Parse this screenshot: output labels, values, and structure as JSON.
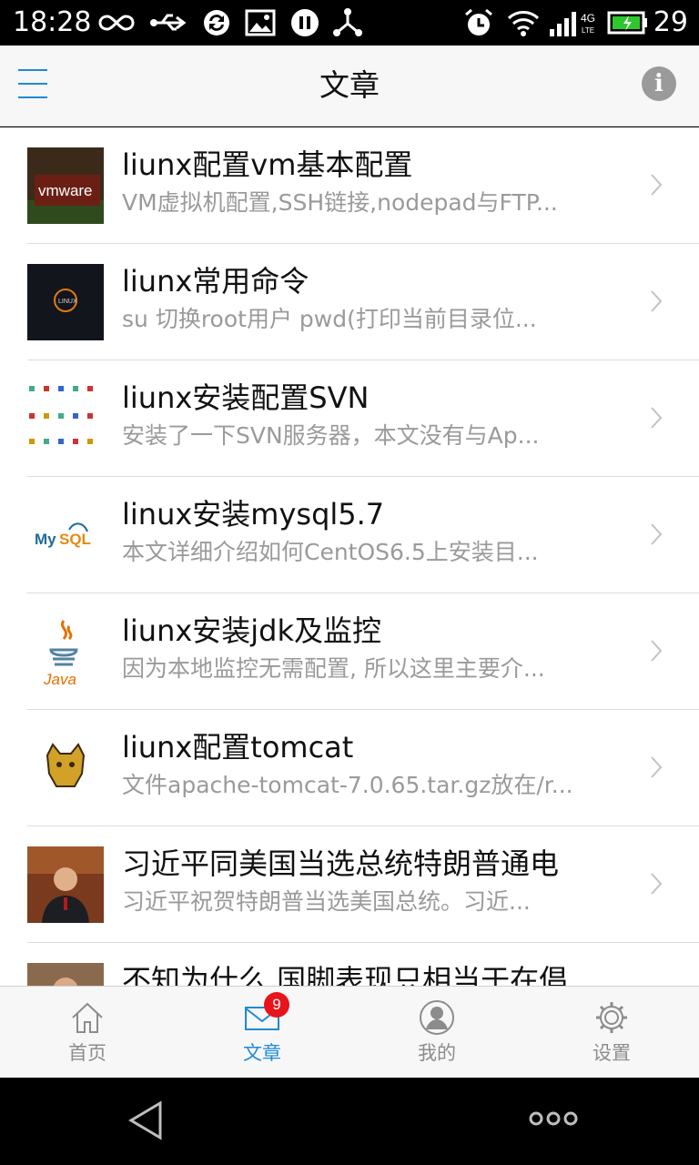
{
  "status_bar": {
    "time": "18:28",
    "battery": "29",
    "network": "4G"
  },
  "header": {
    "title": "文章",
    "menu_icon": "hamburger-menu-icon",
    "info_icon": "info-icon",
    "info_glyph": "i"
  },
  "articles": [
    {
      "title": "liunx配置vm基本配置",
      "summary": "VM虚拟机配置,SSH链接,nodepad与FTP...",
      "thumb": "vmware-logo"
    },
    {
      "title": "liunx常用命令",
      "summary": "su 切换root用户 pwd(打印当前目录位...",
      "thumb": "linux-logo"
    },
    {
      "title": "liunx安装配置SVN",
      "summary": "安装了一下SVN服务器，本文没有与Ap...",
      "thumb": "svn-icons-grid"
    },
    {
      "title": "linux安装mysql5.7",
      "summary": "本文详细介绍如何CentOS6.5上安装目...",
      "thumb": "mysql-logo"
    },
    {
      "title": "liunx安装jdk及监控",
      "summary": "因为本地监控无需配置, 所以这里主要介...",
      "thumb": "java-logo"
    },
    {
      "title": "liunx配置tomcat",
      "summary": "文件apache-tomcat-7.0.65.tar.gz放在/r...",
      "thumb": "tomcat-logo"
    },
    {
      "title": "习近平同美国当选总统特朗普通电",
      "summary": "习近平祝贺特朗普当选美国总统。习近...",
      "thumb": "news-photo"
    },
    {
      "title": "不知为什么 国脚表现只相当于在倡",
      "summary": "",
      "thumb": "news-photo-2"
    }
  ],
  "tabs": [
    {
      "label": "首页",
      "icon": "home-icon",
      "active": false
    },
    {
      "label": "文章",
      "icon": "mail-icon",
      "active": true,
      "badge": "9"
    },
    {
      "label": "我的",
      "icon": "user-icon",
      "active": false
    },
    {
      "label": "设置",
      "icon": "gear-icon",
      "active": false
    }
  ],
  "colors": {
    "accent": "#1e8ad6",
    "badge": "#e8141b",
    "inactive_tab": "#8c8c8c",
    "subtitle": "#9a9a9a"
  }
}
